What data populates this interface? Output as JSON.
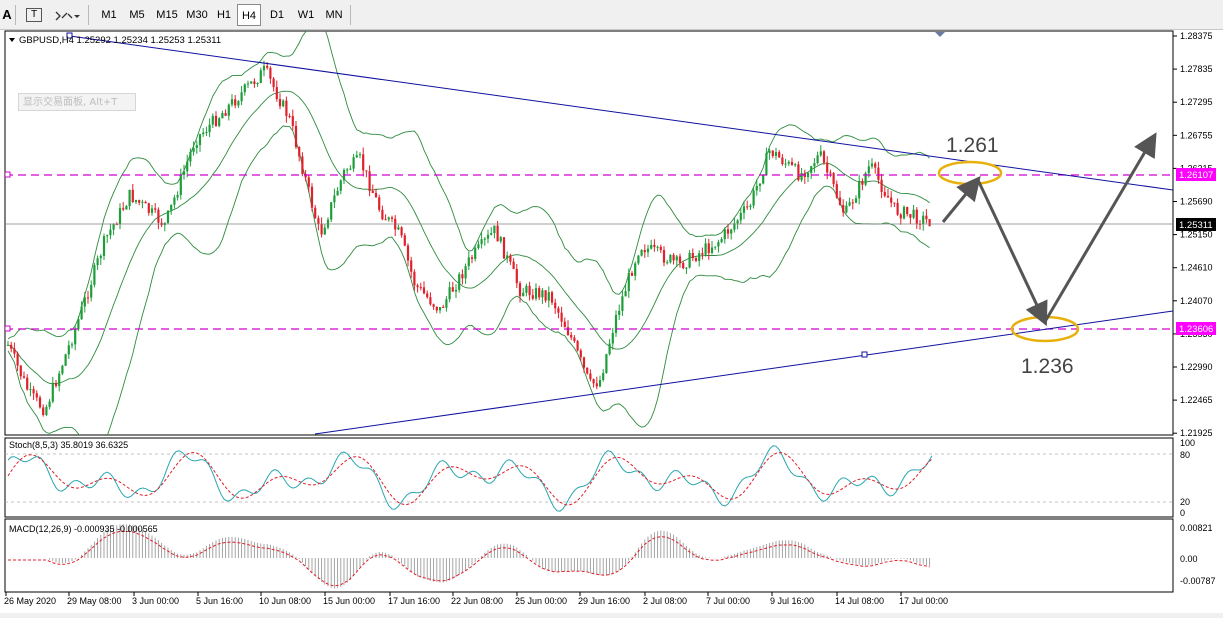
{
  "toolbar": {
    "buttons": [
      "A",
      "T"
    ],
    "timeframes": [
      "M1",
      "M5",
      "M15",
      "M30",
      "H1",
      "H4",
      "D1",
      "W1",
      "MN"
    ],
    "active_timeframe": "H4"
  },
  "chart": {
    "header": "GBPUSD,H4  1.25292 1.25234 1.25253 1.25311",
    "hint": "显示交易面板, Alt+T",
    "price_ticks": [
      "1.28375",
      "1.27835",
      "1.27295",
      "1.26755",
      "1.26215",
      "1.25690",
      "1.25150",
      "1.24610",
      "1.24070",
      "1.23530",
      "1.22990",
      "1.22465",
      "1.21925"
    ],
    "tag_resistance": "1.26107",
    "tag_current": "1.25311",
    "tag_support": "1.23606",
    "annotation_upper": "1.261",
    "annotation_lower": "1.236",
    "time_ticks": [
      "26 May 2020",
      "29 May 08:00",
      "3 Jun 00:00",
      "5 Jun 16:00",
      "10 Jun 08:00",
      "15 Jun 00:00",
      "17 Jun 16:00",
      "22 Jun 08:00",
      "25 Jun 00:00",
      "29 Jun 16:00",
      "2 Jul 08:00",
      "7 Jul 00:00",
      "9 Jul 16:00",
      "14 Jul 08:00",
      "17 Jul 00:00"
    ]
  },
  "stoch": {
    "label": "Stoch(8,5,3) 35.8019 36.6325",
    "ticks": [
      "100",
      "80",
      "20",
      "0"
    ]
  },
  "macd": {
    "label": "MACD(12,26,9) -0.000935 -0.000565",
    "ticks": [
      "0.00821",
      "0.00",
      "-0.00787"
    ]
  },
  "colors": {
    "bull": "#1e9e3a",
    "bear": "#e0202a",
    "trendline": "#1010a0",
    "band": "#2e8b3e",
    "level": "#d000d0",
    "tag_level": "#ff00ff",
    "annotation": "#e7b00a",
    "arrow": "#555555"
  }
}
